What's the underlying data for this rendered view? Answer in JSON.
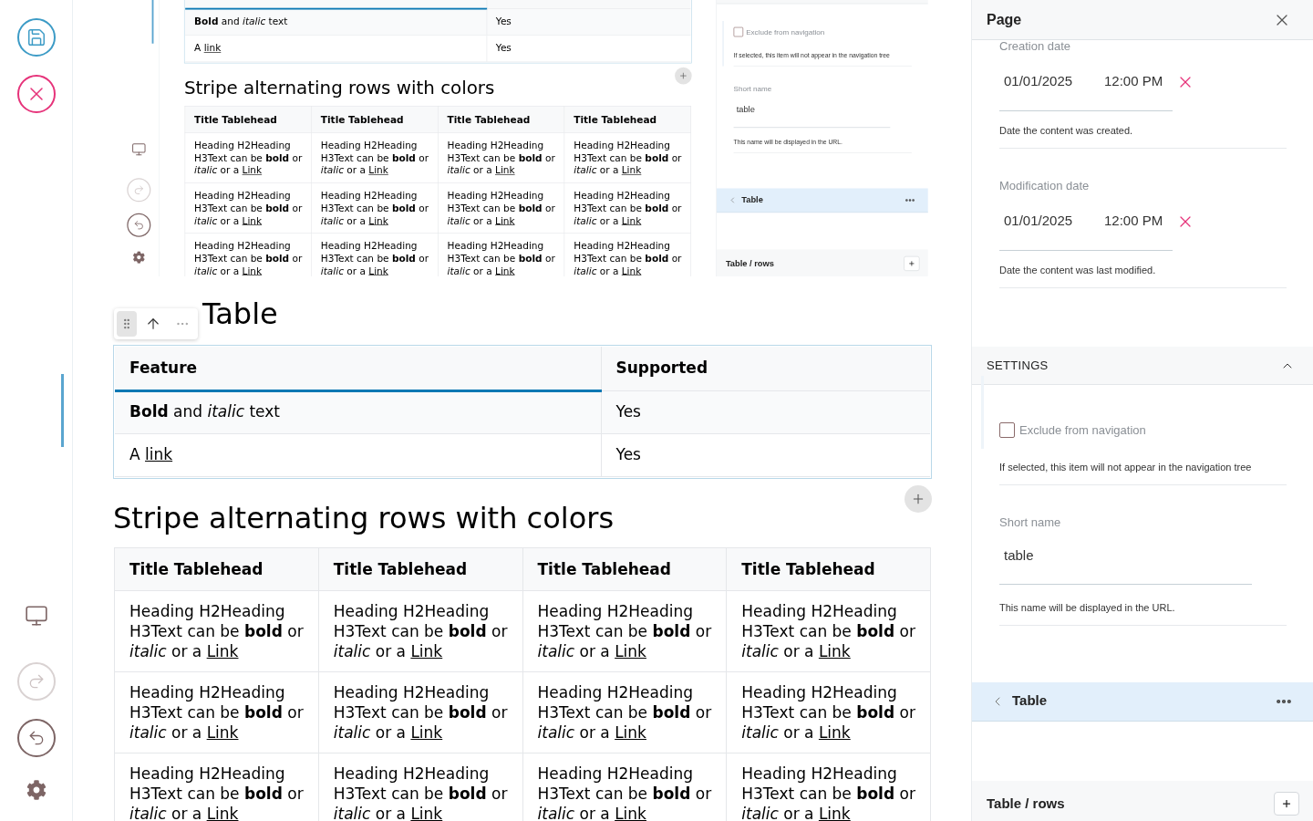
{
  "toolbar": {
    "undo_redo": [
      {
        "kind": "redo",
        "disabled": true
      },
      {
        "kind": "undo",
        "disabled": false
      }
    ]
  },
  "embedded_screenshot": {
    "toolbar": {
      "undo_redo": [
        {
          "kind": "redo",
          "disabled": true
        },
        {
          "kind": "undo",
          "disabled": false
        }
      ]
    },
    "basic_table": {
      "columns": [
        {
          "selected": true
        },
        {
          "selected": false
        }
      ],
      "rows": [
        [
          {
            "text": "**Bold** and *italic* text"
          },
          {
            "text": "Yes"
          }
        ],
        [
          {
            "text": "A",
            "link": "link"
          },
          {
            "text": "Yes"
          }
        ]
      ]
    },
    "stripe_heading": "Stripe alternating rows with colors",
    "stripe_table": {
      "columns": [
        {
          "label": "Title Tablehead",
          "selected": false
        },
        {
          "label": "Title Tablehead",
          "selected": false
        },
        {
          "label": "Title Tablehead",
          "selected": false
        },
        {
          "label": "Title Tablehead",
          "selected": false
        }
      ],
      "rows": [
        [
          {
            "text": "Heading H2Heading H3Text can be **bold** or *italic* or a",
            "link": "Link"
          },
          {
            "text": "Heading H2Heading H3Text can be **bold** or *italic* or a",
            "link": "Link"
          },
          {
            "text": "Heading H2Heading H3Text can be **bold** or *italic* or a",
            "link": "Link"
          },
          {
            "text": "Heading H2Heading H3Text can be **bold** or *italic* or a",
            "link": "Link"
          }
        ],
        [
          {
            "text": "Heading H2Heading H3Text can be **bold** or *italic* or a",
            "link": "Link"
          },
          {
            "text": "Heading H2Heading H3Text can be **bold** or *italic* or a",
            "link": "Link"
          },
          {
            "text": "Heading H2Heading H3Text can be **bold** or *italic* or a",
            "link": "Link"
          },
          {
            "text": "Heading H2Heading H3Text can be **bold** or *italic* or a",
            "link": "Link"
          }
        ],
        [
          {
            "text": "Heading H2Heading H3Text can be **bold** or *italic* or a",
            "link": "Link"
          },
          {
            "text": "Heading H2Heading H3Text can be **bold** or *italic* or a",
            "link": "Link"
          },
          {
            "text": "Heading H2Heading H3Text can be **bold** or *italic* or a",
            "link": "Link"
          },
          {
            "text": "Heading H2Heading H3Text can be **bold** or *italic* or a",
            "link": "Link"
          }
        ]
      ]
    },
    "sidebar": {
      "exclude_checkbox": {
        "label": "Exclude from navigation",
        "checked": false,
        "help": "If selected, this item will not appear in the navigation tree"
      },
      "short_name": {
        "label": "Short name",
        "value": "table",
        "help": "This name will be displayed in the URL."
      },
      "block_bar": {
        "title": "Table"
      },
      "rows_bar": {
        "title": "Table / rows"
      }
    }
  },
  "content": {
    "basic_heading": "Table",
    "basic_table": {
      "columns": [
        {
          "label": "Feature",
          "selected": true
        },
        {
          "label": "Supported",
          "selected": false
        }
      ],
      "rows": [
        [
          {
            "text": "**Bold** and *italic* text"
          },
          {
            "text": "Yes"
          }
        ],
        [
          {
            "text": "A",
            "link": "link"
          },
          {
            "text": "Yes"
          }
        ]
      ]
    },
    "stripe_heading": "Stripe alternating rows with colors",
    "stripe_table": {
      "columns": [
        {
          "label": "Title Tablehead",
          "selected": false
        },
        {
          "label": "Title Tablehead",
          "selected": false
        },
        {
          "label": "Title Tablehead",
          "selected": false
        },
        {
          "label": "Title Tablehead",
          "selected": false
        }
      ],
      "rows": [
        [
          {
            "text": "Heading H2Heading H3Text can be **bold** or *italic* or a",
            "link": "Link"
          },
          {
            "text": "Heading H2Heading H3Text can be **bold** or *italic* or a",
            "link": "Link"
          },
          {
            "text": "Heading H2Heading H3Text can be **bold** or *italic* or a",
            "link": "Link"
          },
          {
            "text": "Heading H2Heading H3Text can be **bold** or *italic* or a",
            "link": "Link"
          }
        ],
        [
          {
            "text": "Heading H2Heading H3Text can be **bold** or *italic* or a",
            "link": "Link"
          },
          {
            "text": "Heading H2Heading H3Text can be **bold** or *italic* or a",
            "link": "Link"
          },
          {
            "text": "Heading H2Heading H3Text can be **bold** or *italic* or a",
            "link": "Link"
          },
          {
            "text": "Heading H2Heading H3Text can be **bold** or *italic* or a",
            "link": "Link"
          }
        ],
        [
          {
            "text": "Heading H2Heading H3Text can be **bold** or *italic* or a",
            "link": "Link"
          },
          {
            "text": "Heading H2Heading H3Text can be **bold** or *italic* or a",
            "link": "Link"
          },
          {
            "text": "Heading H2Heading H3Text can be **bold** or *italic* or a",
            "link": "Link"
          },
          {
            "text": "Heading H2Heading H3Text can be **bold** or *italic* or a",
            "link": "Link"
          }
        ]
      ]
    }
  },
  "sidebar": {
    "title": "Page",
    "dates": [
      {
        "label": "Creation date",
        "date": "01/01/2025",
        "time": "12:00 PM",
        "help": "Date the content was created."
      },
      {
        "label": "Modification date",
        "date": "01/01/2025",
        "time": "12:00 PM",
        "help": "Date the content was last modified."
      }
    ],
    "settings": {
      "title": "SETTINGS",
      "expanded": true
    },
    "exclude_checkbox": {
      "label": "Exclude from navigation",
      "checked": false,
      "help": "If selected, this item will not appear in the navigation tree"
    },
    "short_name": {
      "label": "Short name",
      "value": "table",
      "help": "This name will be displayed in the URL."
    },
    "block_bar": {
      "title": "Table"
    },
    "rows_bar": {
      "title": "Table / rows"
    }
  }
}
